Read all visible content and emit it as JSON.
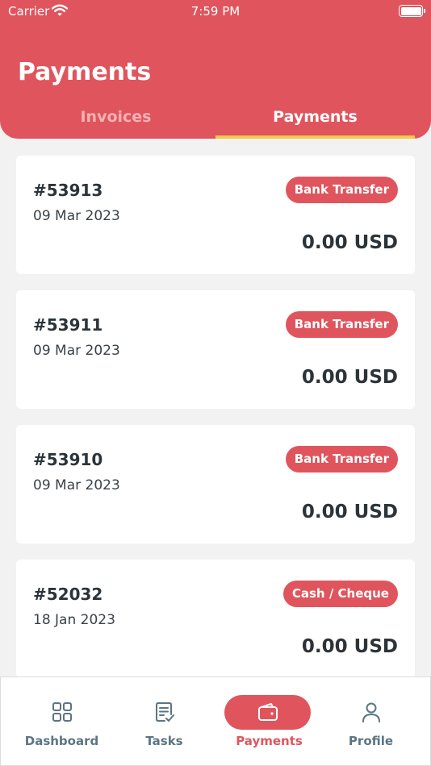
{
  "status": {
    "carrier": "Carrier",
    "time": "7:59 PM"
  },
  "header": {
    "title": "Payments"
  },
  "tabs": [
    {
      "label": "Invoices",
      "active": false
    },
    {
      "label": "Payments",
      "active": true
    }
  ],
  "payments": [
    {
      "ref": "#53913",
      "date": "09 Mar 2023",
      "method": "Bank Transfer",
      "amount": "0.00 USD"
    },
    {
      "ref": "#53911",
      "date": "09 Mar 2023",
      "method": "Bank Transfer",
      "amount": "0.00 USD"
    },
    {
      "ref": "#53910",
      "date": "09 Mar 2023",
      "method": "Bank Transfer",
      "amount": "0.00 USD"
    },
    {
      "ref": "#52032",
      "date": "18 Jan 2023",
      "method": "Cash / Cheque",
      "amount": "0.00 USD"
    }
  ],
  "nav": [
    {
      "label": "Dashboard",
      "icon": "grid-icon"
    },
    {
      "label": "Tasks",
      "icon": "task-list-icon"
    },
    {
      "label": "Payments",
      "icon": "wallet-icon"
    },
    {
      "label": "Profile",
      "icon": "user-icon"
    }
  ],
  "colors": {
    "brand": "#e0555d",
    "accent": "#f2c94c",
    "nav_inactive": "#5b7583"
  }
}
